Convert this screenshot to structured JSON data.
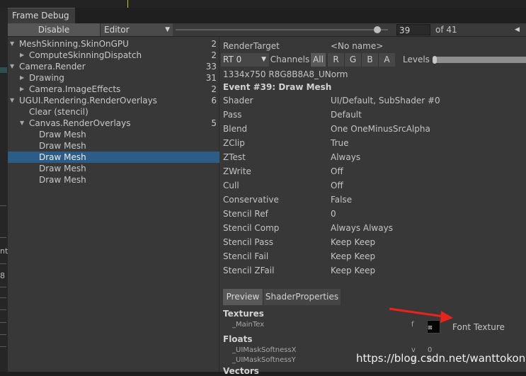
{
  "window": {
    "tab_title": "Frame Debug"
  },
  "toolbar": {
    "disable_label": "Disable",
    "editor_label": "Editor",
    "frame_value": "39",
    "frame_total": "of 41",
    "slider_fraction": 0.95
  },
  "tree": [
    {
      "label": "MeshSkinning.SkinOnGPU",
      "count": "2",
      "depth": 0,
      "expander": "expanded"
    },
    {
      "label": "ComputeSkinningDispatch",
      "count": "2",
      "depth": 1,
      "expander": "collapsed"
    },
    {
      "label": "Camera.Render",
      "count": "33",
      "depth": 0,
      "expander": "expanded"
    },
    {
      "label": "Drawing",
      "count": "31",
      "depth": 1,
      "expander": "collapsed"
    },
    {
      "label": "Camera.ImageEffects",
      "count": "2",
      "depth": 1,
      "expander": "collapsed"
    },
    {
      "label": "UGUI.Rendering.RenderOverlays",
      "count": "6",
      "depth": 0,
      "expander": "expanded"
    },
    {
      "label": "Clear (stencil)",
      "count": "",
      "depth": 1,
      "expander": "none"
    },
    {
      "label": "Canvas.RenderOverlays",
      "count": "5",
      "depth": 1,
      "expander": "expanded"
    },
    {
      "label": "Draw Mesh",
      "count": "",
      "depth": 2,
      "expander": "none"
    },
    {
      "label": "Draw Mesh",
      "count": "",
      "depth": 2,
      "expander": "none"
    },
    {
      "label": "Draw Mesh",
      "count": "",
      "depth": 2,
      "expander": "none",
      "selected": true
    },
    {
      "label": "Draw Mesh",
      "count": "",
      "depth": 2,
      "expander": "none"
    },
    {
      "label": "Draw Mesh",
      "count": "",
      "depth": 2,
      "expander": "none"
    }
  ],
  "render_target": {
    "label": "RenderTarget",
    "value": "<No name>",
    "rt_select": "RT 0",
    "channels_label": "Channels",
    "channels": [
      "All",
      "R",
      "G",
      "B",
      "A"
    ],
    "levels_label": "Levels",
    "format": "1334x750 R8G8B8A8_UNorm"
  },
  "event": {
    "title": "Event #39: Draw Mesh",
    "properties": [
      {
        "name": "Shader",
        "value": "UI/Default, SubShader #0"
      },
      {
        "name": "Pass",
        "value": "Default"
      },
      {
        "name": "Blend",
        "value": "One OneMinusSrcAlpha"
      },
      {
        "name": "ZClip",
        "value": "True"
      },
      {
        "name": "ZTest",
        "value": "Always"
      },
      {
        "name": "ZWrite",
        "value": "Off"
      },
      {
        "name": "Cull",
        "value": "Off"
      },
      {
        "name": "Conservative",
        "value": "False"
      },
      {
        "name": "Stencil Ref",
        "value": "0"
      },
      {
        "name": "Stencil Comp",
        "value": "Always Always"
      },
      {
        "name": "Stencil Pass",
        "value": "Keep Keep"
      },
      {
        "name": "Stencil Fail",
        "value": "Keep Keep"
      },
      {
        "name": "Stencil ZFail",
        "value": "Keep Keep"
      }
    ]
  },
  "tabs": {
    "preview": "Preview",
    "shader_properties": "ShaderProperties"
  },
  "shader_props": {
    "textures_header": "Textures",
    "main_tex": "_MainTex",
    "main_tex_stage": "f",
    "main_tex_name": "Font Texture",
    "floats_header": "Floats",
    "float1": "_UIMaskSoftnessX",
    "float1_stage": "v",
    "float1_value": "0",
    "float2": "_UIMaskSoftnessY",
    "float2_stage": "v",
    "float2_value": "0",
    "vectors_header": "Vectors"
  },
  "left_fragments": [
    "nt",
    "8"
  ],
  "watermark": "https://blog.csdn.net/wanttokonw",
  "colors": {
    "selection": "#2c5d87",
    "annotation_arrow": "#e8241c",
    "panel": "#383838"
  }
}
